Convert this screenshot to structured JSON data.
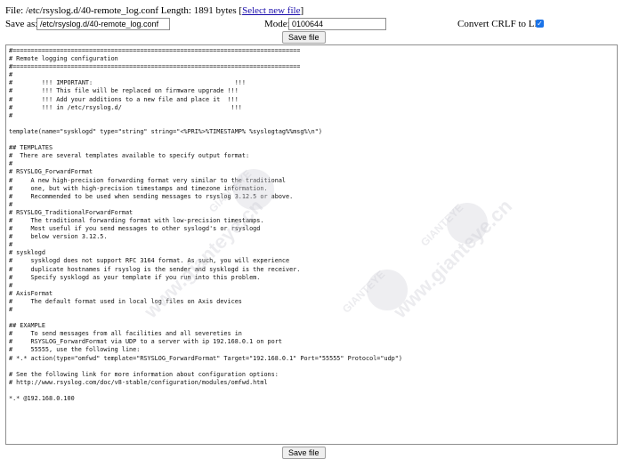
{
  "header": {
    "file_prefix": "File: /etc/rsyslog.d/40-remote_log.conf Length: 1891 bytes [",
    "select_link": "Select new file",
    "file_suffix": "]"
  },
  "form": {
    "save_as_label": "Save as:",
    "save_as_value": "/etc/rsyslog.d/40-remote_log.conf",
    "mode_label": "Mode:",
    "mode_value": "0100644",
    "convert_label": "Convert CRLF to LF:",
    "convert_checked": "✓",
    "save_button": "Save file"
  },
  "editor": {
    "content": "#===============================================================================\n# Remote logging configuration\n#===============================================================================\n#\n#        !!! IMPORTANT:                                       !!!\n#        !!! This file will be replaced on firmware upgrade !!!\n#        !!! Add your additions to a new file and place it  !!!\n#        !!! in /etc/rsyslog.d/                              !!!\n#\n\ntemplate(name=\"sysklogd\" type=\"string\" string=\"<%PRI%>%TIMESTAMP% %syslogtag%%msg%\\n\")\n\n## TEMPLATES\n#  There are several templates available to specify output format:\n#\n# RSYSLOG_ForwardFormat\n#     A new high-precision forwarding format very similar to the traditional\n#     one, but with high-precision timestamps and timezone information.\n#     Recommended to be used when sending messages to rsyslog 3.12.5 or above.\n#\n# RSYSLOG_TraditionalForwardFormat\n#     The traditional forwarding format with low-precision timestamps.\n#     Most useful if you send messages to other syslogd's or rsyslogd\n#     below version 3.12.5.\n#\n# sysklogd\n#     sysklogd does not support RFC 3164 format. As such, you will experience\n#     duplicate hostnames if rsyslog is the sender and sysklogd is the receiver.\n#     Specify sysklogd as your template if you run into this problem.\n#\n# AxisFormat\n#     The default format used in local log files on Axis devices\n#\n\n## EXAMPLE\n#     To send messages from all facilities and all severeties in\n#     RSYSLOG_ForwardFormat via UDP to a server with ip 192.168.0.1 on port\n#     55555, use the following line:\n# *.* action(type=\"omfwd\" template=\"RSYSLOG_ForwardFormat\" Target=\"192.168.0.1\" Port=\"55555\" Protocol=\"udp\")\n\n# See the following link for more information about configuration options:\n# http://www.rsyslog.com/doc/v8-stable/configuration/modules/omfwd.html\n\n*.* @192.168.0.100"
  },
  "watermark": {
    "brand": "GIANTEYE",
    "site": "www.gianteye.cn"
  },
  "colors": {
    "link": "#1a0dab",
    "checkbox": "#1a73e8"
  }
}
